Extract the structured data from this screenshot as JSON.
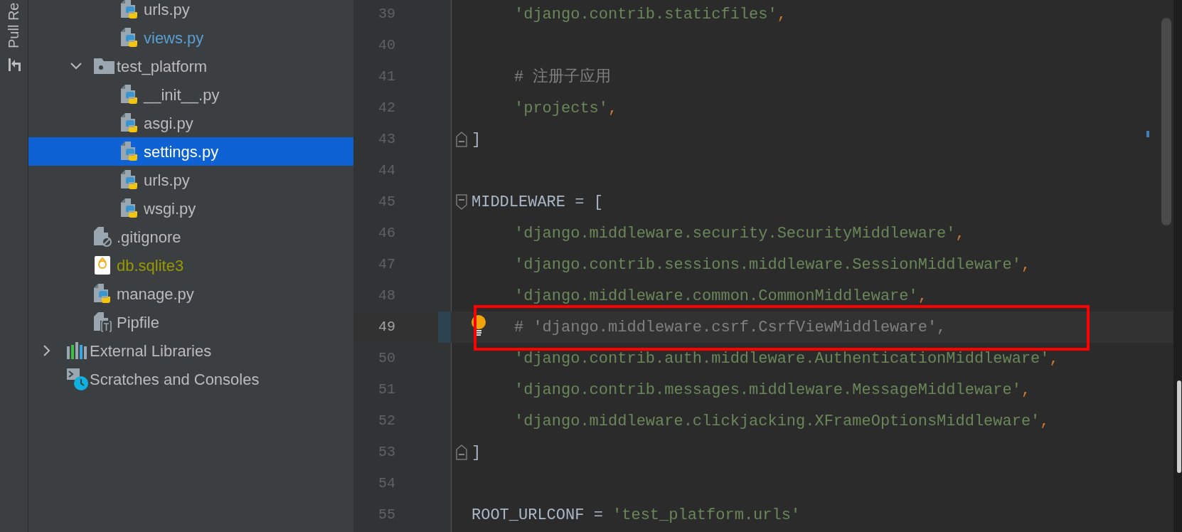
{
  "tool_strip": {
    "label": "Pull Re"
  },
  "project_tree": [
    {
      "children": [
        {
          "children": [
            {
              "label": "urls.py",
              "kind": "python",
              "color": "#bbbbbb",
              "selected": false
            },
            {
              "label": "views.py",
              "kind": "python",
              "color": "#5a9fd4",
              "selected": false
            }
          ]
        },
        {
          "label": "test_platform",
          "kind": "folder",
          "color": "#bbbbbb",
          "selected": false,
          "expanded": true,
          "children": [
            {
              "label": "__init__.py",
              "kind": "python",
              "color": "#bbbbbb",
              "selected": false
            },
            {
              "label": "asgi.py",
              "kind": "python",
              "color": "#bbbbbb",
              "selected": false
            },
            {
              "label": "settings.py",
              "kind": "python",
              "color": "#ffffff",
              "selected": true
            },
            {
              "label": "urls.py",
              "kind": "python",
              "color": "#bbbbbb",
              "selected": false
            },
            {
              "label": "wsgi.py",
              "kind": "python",
              "color": "#bbbbbb",
              "selected": false
            }
          ]
        },
        {
          "label": ".gitignore",
          "kind": "gitignore",
          "color": "#bbbbbb",
          "selected": false
        },
        {
          "label": "db.sqlite3",
          "kind": "sqlite",
          "color": "#999900",
          "selected": false
        },
        {
          "label": "manage.py",
          "kind": "python",
          "color": "#bbbbbb",
          "selected": false
        },
        {
          "label": "Pipfile",
          "kind": "pipfile",
          "color": "#bbbbbb",
          "selected": false
        }
      ]
    },
    {
      "label": "External Libraries",
      "kind": "libraries",
      "color": "#bbbbbb",
      "selected": false,
      "expanded": false
    },
    {
      "label": "Scratches and Consoles",
      "kind": "scratches",
      "color": "#bbbbbb",
      "selected": false
    }
  ],
  "editor": {
    "lines": [
      {
        "number": "39",
        "indented": true,
        "segments": [
          {
            "kind": "string",
            "text": "'django.contrib.staticfiles'"
          },
          {
            "kind": "punct",
            "text": ","
          }
        ]
      },
      {
        "number": "40"
      },
      {
        "number": "41",
        "indented": true,
        "segments": [
          {
            "kind": "comment",
            "text": "# 注册子应用"
          }
        ]
      },
      {
        "number": "42",
        "indented": true,
        "segments": [
          {
            "kind": "string",
            "text": "'projects'"
          },
          {
            "kind": "punct",
            "text": ","
          }
        ]
      },
      {
        "number": "43",
        "indented": false,
        "fold_close": true,
        "segments": [
          {
            "kind": "plain",
            "text": "]"
          }
        ]
      },
      {
        "number": "44"
      },
      {
        "number": "45",
        "indented": false,
        "fold_open": true,
        "segments": [
          {
            "kind": "plain",
            "text": "MIDDLEWARE = ["
          }
        ]
      },
      {
        "number": "46",
        "indented": true,
        "segments": [
          {
            "kind": "string",
            "text": "'django.middleware.security.SecurityMiddleware'"
          },
          {
            "kind": "punct",
            "text": ","
          }
        ]
      },
      {
        "number": "47",
        "indented": true,
        "segments": [
          {
            "kind": "string",
            "text": "'django.contrib.sessions.middleware.SessionMiddleware'"
          },
          {
            "kind": "punct",
            "text": ","
          }
        ]
      },
      {
        "number": "48",
        "indented": true,
        "segments": [
          {
            "kind": "string",
            "text": "'django.middleware.common.CommonMiddleware'"
          },
          {
            "kind": "punct",
            "text": ","
          }
        ]
      },
      {
        "number": "49",
        "indented": true,
        "current": true,
        "boxed": true,
        "bulb": true,
        "segments": [
          {
            "kind": "comment",
            "text": "# 'django.middleware.csrf.CsrfViewMiddleware',"
          }
        ]
      },
      {
        "number": "50",
        "indented": true,
        "segments": [
          {
            "kind": "string",
            "text": "'django.contrib.auth.middleware.AuthenticationMiddleware'"
          },
          {
            "kind": "punct",
            "text": ","
          }
        ]
      },
      {
        "number": "51",
        "indented": true,
        "segments": [
          {
            "kind": "string",
            "text": "'django.contrib.messages.middleware.MessageMiddleware'"
          },
          {
            "kind": "punct",
            "text": ","
          }
        ]
      },
      {
        "number": "52",
        "indented": true,
        "segments": [
          {
            "kind": "string",
            "text": "'django.middleware.clickjacking.XFrameOptionsMiddleware'"
          },
          {
            "kind": "punct",
            "text": ","
          }
        ]
      },
      {
        "number": "53",
        "indented": false,
        "fold_close": true,
        "segments": [
          {
            "kind": "plain",
            "text": "]"
          }
        ]
      },
      {
        "number": "54"
      },
      {
        "number": "55",
        "indented": false,
        "segments": [
          {
            "kind": "plain",
            "text": "ROOT_URLCONF = "
          },
          {
            "kind": "string",
            "text": "'test_platform.urls'"
          }
        ]
      }
    ]
  }
}
